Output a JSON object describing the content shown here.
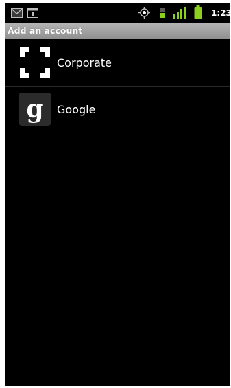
{
  "status_bar": {
    "time": "1:23",
    "icons": [
      "gmail-icon",
      "calendar-icon",
      "gps-icon",
      "data-3g-icon",
      "signal-icon",
      "battery-icon"
    ]
  },
  "header": {
    "title": "Add an account"
  },
  "accounts": [
    {
      "label": "Corporate",
      "icon": "corporate-icon"
    },
    {
      "label": "Google",
      "icon": "google-icon"
    }
  ],
  "colors": {
    "background": "#000000",
    "title_bar": "#a0a0a0",
    "signal_green": "#8ccf1e",
    "text": "#ffffff"
  }
}
